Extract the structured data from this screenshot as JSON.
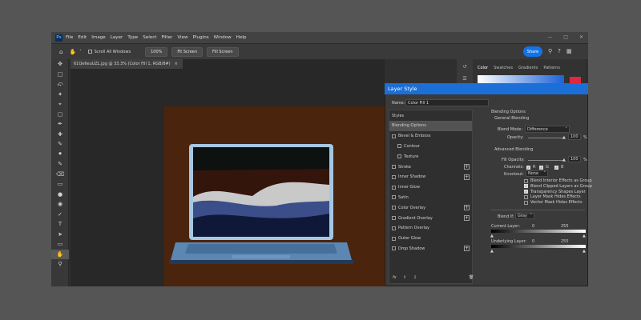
{
  "app": {
    "logo": "Ps"
  },
  "menu": [
    "File",
    "Edit",
    "Image",
    "Layer",
    "Type",
    "Select",
    "Filter",
    "View",
    "Plugins",
    "Window",
    "Help"
  ],
  "options_bar": {
    "scroll_all_windows": "Scroll All Windows",
    "zoom_100": "100%",
    "fit_screen": "Fit Screen",
    "fill_screen": "Fill Screen",
    "share": "Share"
  },
  "document": {
    "tab_title": "61Qe6euUZL.jpg @ 33.3% (Color Fill 1, RGB/8#)"
  },
  "right_panel": {
    "tabs": [
      "Color",
      "Swatches",
      "Gradients",
      "Patterns"
    ],
    "accent": "#e0283f"
  },
  "dialog": {
    "title": "Layer Style",
    "name_label": "Name:",
    "name_value": "Color Fill 1",
    "styles_header": "Styles",
    "styles": [
      {
        "label": "Blending Options",
        "checkbox": false,
        "plus": false,
        "selected": true
      },
      {
        "label": "Bevel & Emboss",
        "checkbox": true,
        "plus": false
      },
      {
        "label": "Contour",
        "checkbox": true,
        "plus": false,
        "indent": true
      },
      {
        "label": "Texture",
        "checkbox": true,
        "plus": false,
        "indent": true
      },
      {
        "label": "Stroke",
        "checkbox": true,
        "plus": true
      },
      {
        "label": "Inner Shadow",
        "checkbox": true,
        "plus": true
      },
      {
        "label": "Inner Glow",
        "checkbox": true,
        "plus": false
      },
      {
        "label": "Satin",
        "checkbox": true,
        "plus": false
      },
      {
        "label": "Color Overlay",
        "checkbox": true,
        "plus": true
      },
      {
        "label": "Gradient Overlay",
        "checkbox": true,
        "plus": true
      },
      {
        "label": "Pattern Overlay",
        "checkbox": true,
        "plus": false
      },
      {
        "label": "Outer Glow",
        "checkbox": true,
        "plus": false
      },
      {
        "label": "Drop Shadow",
        "checkbox": true,
        "plus": true
      }
    ],
    "fx_label": "fx",
    "blending_options": "Blending Options",
    "general_blending": "General Blending",
    "blend_mode_label": "Blend Mode:",
    "blend_mode_value": "Difference",
    "opacity_label": "Opacity:",
    "opacity_value": "100",
    "advanced_blending": "Advanced Blending",
    "fill_opacity_label": "Fill Opacity:",
    "fill_opacity_value": "100",
    "channels_label": "Channels:",
    "channels": [
      "R",
      "G",
      "B"
    ],
    "knockout_label": "Knockout:",
    "knockout_value": "None",
    "checks": [
      {
        "label": "Blend Interior Effects as Group",
        "checked": false
      },
      {
        "label": "Blend Clipped Layers as Group",
        "checked": true
      },
      {
        "label": "Transparency Shapes Layer",
        "checked": true
      },
      {
        "label": "Layer Mask Hides Effects",
        "checked": false
      },
      {
        "label": "Vector Mask Hides Effects",
        "checked": false
      }
    ],
    "blend_if_label": "Blend If:",
    "blend_if_value": "Gray",
    "current_layer_label": "Current Layer:",
    "current_min": "0",
    "current_max": "255",
    "underlying_label": "Underlying Layer:",
    "underlying_min": "0",
    "underlying_max": "255",
    "pct": "%"
  }
}
